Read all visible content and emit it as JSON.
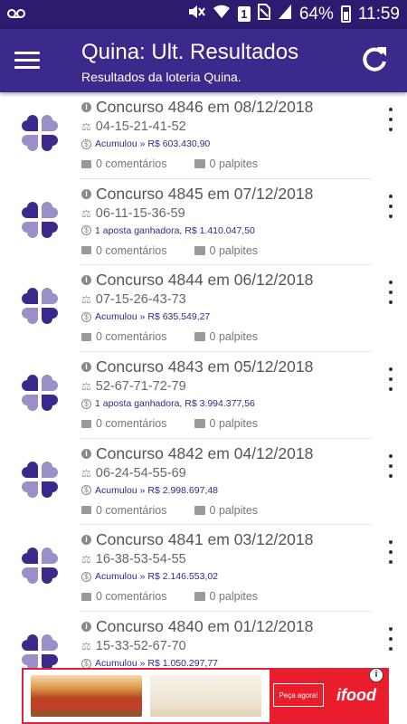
{
  "status_bar": {
    "left_icon": "voicemail-icon",
    "sim_slot": "1",
    "battery_percent": "64%",
    "time": "11:59"
  },
  "app_bar": {
    "title": "Quina: Ult. Resultados",
    "subtitle": "Resultados da loteria Quina.",
    "menu_icon": "hamburger-menu-icon",
    "refresh_icon": "refresh-icon"
  },
  "colors": {
    "status_bar": "#2c1b6f",
    "app_bar": "#3b2a8c",
    "clover_dark": "#3b2a8c",
    "clover_light": "#9b8fc7",
    "prize_text": "#2b2b8a",
    "ad_brand": "#ea1d2c"
  },
  "results": [
    {
      "title": "Concurso 4846 em 08/12/2018",
      "numbers": "04-15-21-41-52",
      "prize": "Acumulou » R$ 603.430,90",
      "comments": "0 comentários",
      "guesses": "0 palpites"
    },
    {
      "title": "Concurso 4845 em 07/12/2018",
      "numbers": "06-11-15-36-59",
      "prize": "1 aposta ganhadora, R$ 1.410.047,50",
      "comments": "0 comentários",
      "guesses": "0 palpites"
    },
    {
      "title": "Concurso 4844 em 06/12/2018",
      "numbers": "07-15-26-43-73",
      "prize": "Acumulou » R$ 635.549,27",
      "comments": "0 comentários",
      "guesses": "0 palpites"
    },
    {
      "title": "Concurso 4843 em 05/12/2018",
      "numbers": "52-67-71-72-79",
      "prize": "1 aposta ganhadora, R$ 3.994.377,56",
      "comments": "0 comentários",
      "guesses": "0 palpites"
    },
    {
      "title": "Concurso 4842 em 04/12/2018",
      "numbers": "06-24-54-55-69",
      "prize": "Acumulou » R$ 2.998.697,48",
      "comments": "0 comentários",
      "guesses": "0 palpites"
    },
    {
      "title": "Concurso 4841 em 03/12/2018",
      "numbers": "16-38-53-54-55",
      "prize": "Acumulou » R$ 2.146.553,02",
      "comments": "0 comentários",
      "guesses": "0 palpites"
    },
    {
      "title": "Concurso 4840 em 01/12/2018",
      "numbers": "15-33-52-67-70",
      "prize": "Acumulou » R$ 1.050.297,77",
      "comments": "",
      "guesses": ""
    }
  ],
  "ad": {
    "cta": "Peça agora!",
    "brand": "ifood",
    "info_icon": "info-icon"
  }
}
